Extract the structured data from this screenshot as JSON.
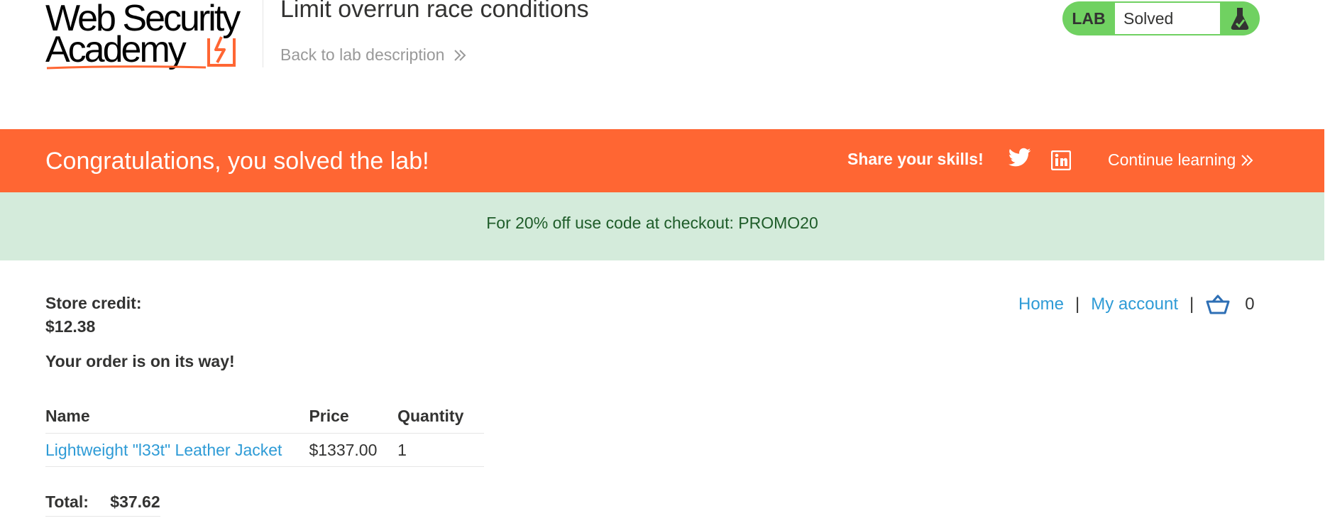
{
  "header": {
    "logo_line1": "Web Security",
    "logo_line2": "Academy",
    "lab_title": "Limit overrun race conditions",
    "back_link": "Back to lab description",
    "lab_tag": "LAB",
    "lab_status": "Solved"
  },
  "banner": {
    "message": "Congratulations, you solved the lab!",
    "share_label": "Share your skills!",
    "continue_label": "Continue learning"
  },
  "promo": {
    "text": "For 20% off use code at checkout: PROMO20"
  },
  "account": {
    "credit_label": "Store credit:",
    "credit_value": "$12.38"
  },
  "nav": {
    "home": "Home",
    "separator": "|",
    "my_account": "My account",
    "cart_count": "0"
  },
  "order": {
    "message": "Your order is on its way!",
    "columns": [
      "Name",
      "Price",
      "Quantity"
    ],
    "rows": [
      {
        "name": "Lightweight \"l33t\" Leather Jacket",
        "price": "$1337.00",
        "quantity": "1"
      }
    ],
    "total_label": "Total:",
    "total_value": "$37.62"
  },
  "icons": [
    "logo-icon",
    "chevron-right-icon",
    "flask-icon",
    "twitter-icon",
    "linkedin-icon",
    "cart-icon"
  ],
  "colors": {
    "brand_orange": "#ff6633",
    "solved_green": "#70d161",
    "promo_bg": "#d4ebdb",
    "link_blue": "#2e9bd6"
  }
}
